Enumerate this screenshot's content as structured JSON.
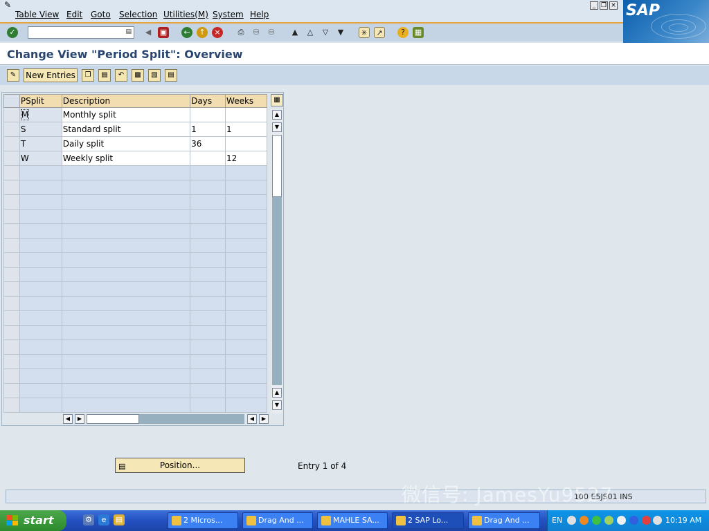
{
  "menubar": {
    "items": [
      {
        "label": "Table View"
      },
      {
        "label": "Edit"
      },
      {
        "label": "Goto"
      },
      {
        "label": "Selection"
      },
      {
        "label": "Utilities(M)"
      },
      {
        "label": "System"
      },
      {
        "label": "Help"
      }
    ],
    "logo": "SAP"
  },
  "toolbar": {
    "command_value": "",
    "icons": [
      "enter-icon",
      "back-icon",
      "save-icon",
      "back-green-icon",
      "exit-icon",
      "cancel-icon",
      "print-icon",
      "find-icon",
      "find-next-icon",
      "first-page-icon",
      "previous-page-icon",
      "next-page-icon",
      "last-page-icon",
      "create-session-icon",
      "shortcut-icon",
      "help-icon",
      "layout-icon"
    ]
  },
  "page": {
    "title": "Change View \"Period Split\": Overview"
  },
  "app_toolbar": {
    "new_entries_label": "New Entries"
  },
  "table": {
    "columns": [
      "PSplit",
      "Description",
      "Days",
      "Weeks"
    ],
    "rows": [
      {
        "psplit": "M",
        "description": "Monthly split",
        "days": "",
        "weeks": ""
      },
      {
        "psplit": "S",
        "description": "Standard split",
        "days": "1",
        "weeks": "1"
      },
      {
        "psplit": "T",
        "description": "Daily split",
        "days": "36",
        "weeks": ""
      },
      {
        "psplit": "W",
        "description": "Weekly split",
        "days": "",
        "weeks": "12"
      }
    ]
  },
  "footer": {
    "position_label": "Position...",
    "entry_info": "Entry 1 of 4"
  },
  "statusbar": {
    "info": "100  E5JS01  INS"
  },
  "watermark": "微信号: JamesYu9527",
  "taskbar": {
    "start_label": "start",
    "tasks": [
      {
        "label": "2 Micros..."
      },
      {
        "label": "Drag And ..."
      },
      {
        "label": "MAHLE SA..."
      },
      {
        "label": "2 SAP Lo..."
      },
      {
        "label": "Drag And ..."
      }
    ],
    "tray_lang": "EN",
    "clock": "10:19 AM"
  },
  "colors": {
    "title": "#2a4670",
    "header_cell": "#f2ddb0",
    "empty_row": "#d3dfee",
    "accent_orange": "#e8a23c",
    "taskbar_blue": "#2450c0"
  }
}
